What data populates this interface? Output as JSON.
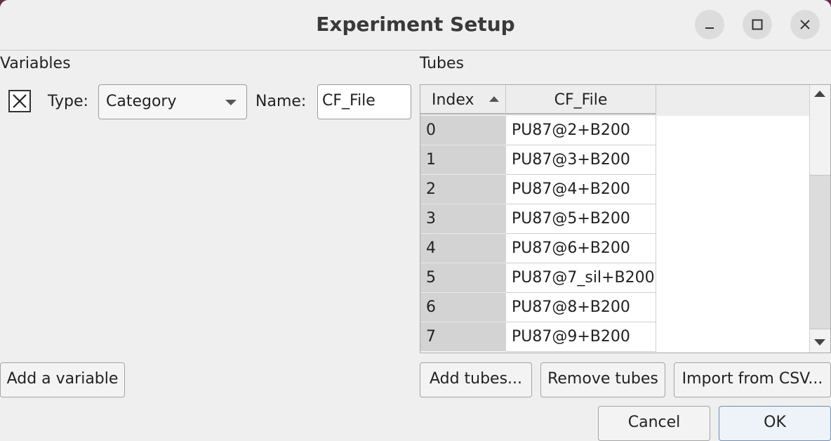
{
  "window": {
    "title": "Experiment Setup"
  },
  "variables": {
    "section_label": "Variables",
    "type_label": "Type:",
    "type_value": "Category",
    "name_label": "Name:",
    "name_value": "CF_File",
    "add_button": "Add a variable",
    "remove_icon": "close-x-icon"
  },
  "tubes": {
    "section_label": "Tubes",
    "columns": [
      "Index",
      "CF_File"
    ],
    "rows": [
      {
        "index": "0",
        "cf_file": "PU87@2+B200"
      },
      {
        "index": "1",
        "cf_file": "PU87@3+B200"
      },
      {
        "index": "2",
        "cf_file": "PU87@4+B200"
      },
      {
        "index": "3",
        "cf_file": "PU87@5+B200"
      },
      {
        "index": "4",
        "cf_file": "PU87@6+B200"
      },
      {
        "index": "5",
        "cf_file": "PU87@7_sil+B200"
      },
      {
        "index": "6",
        "cf_file": "PU87@8+B200"
      },
      {
        "index": "7",
        "cf_file": "PU87@9+B200"
      }
    ],
    "add_button": "Add tubes...",
    "remove_button": "Remove tubes",
    "import_button": "Import from CSV..."
  },
  "footer": {
    "cancel": "Cancel",
    "ok": "OK"
  }
}
